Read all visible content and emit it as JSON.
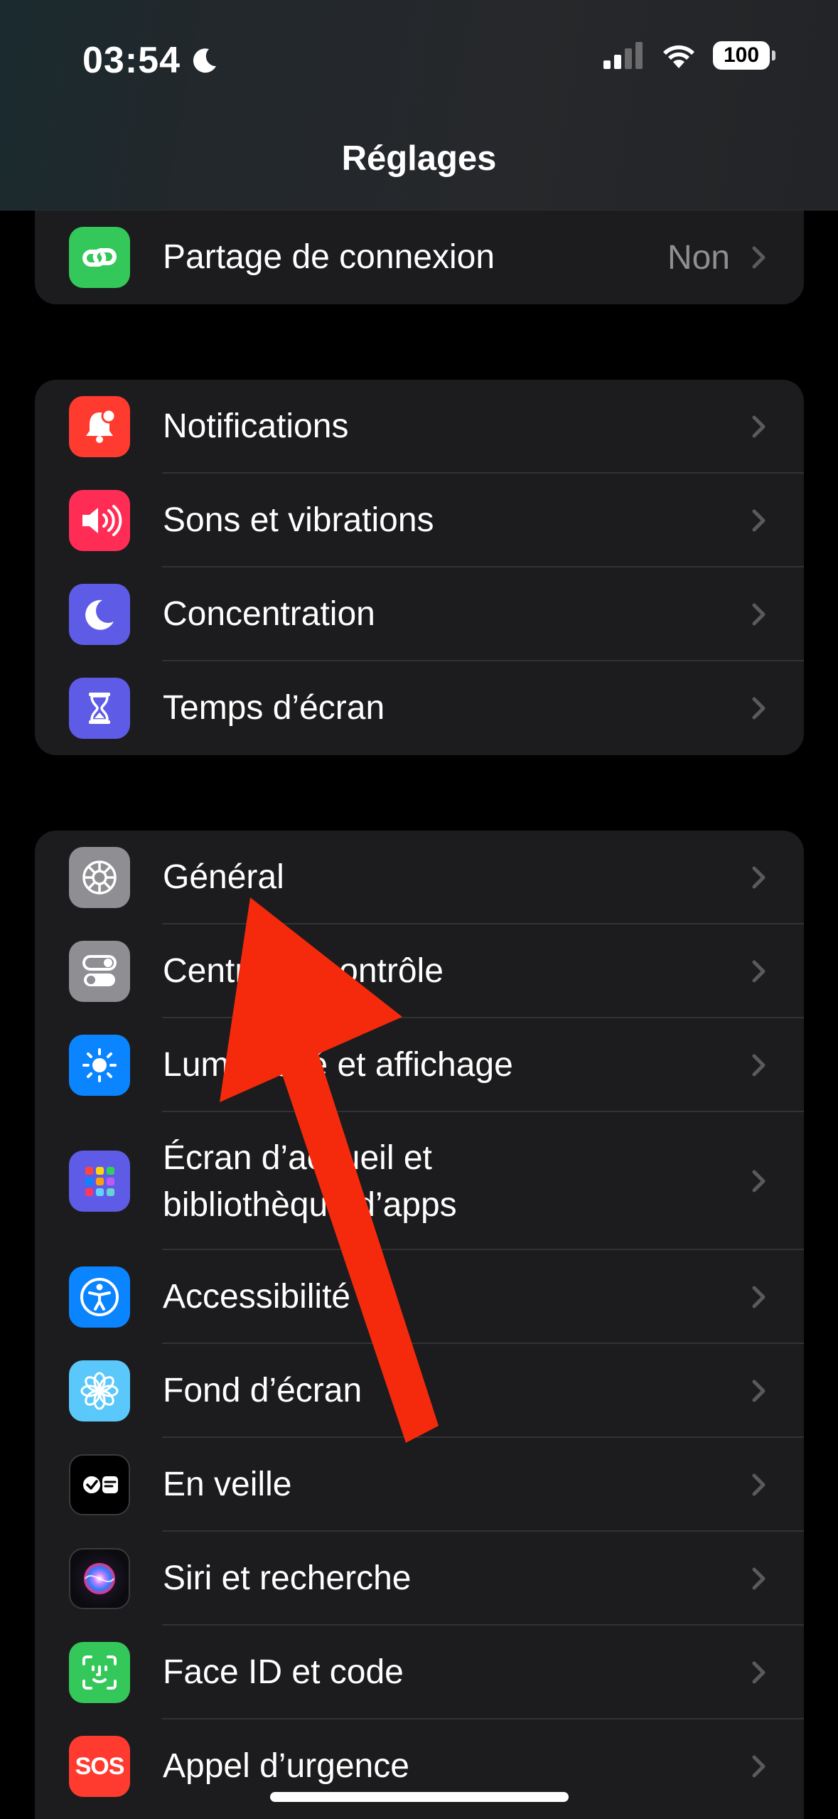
{
  "status": {
    "time": "03:54",
    "battery": "100"
  },
  "nav": {
    "title": "Réglages"
  },
  "colors": {
    "accent_arrow": "#f52a0c",
    "secondary_text": "#8e8e93"
  },
  "groups": [
    {
      "items": [
        {
          "label": "Partage de connexion",
          "value": "Non",
          "icon": "hotspot-icon"
        }
      ]
    },
    {
      "items": [
        {
          "label": "Notifications",
          "icon": "bell-icon"
        },
        {
          "label": "Sons et vibrations",
          "icon": "speaker-icon"
        },
        {
          "label": "Concentration",
          "icon": "moon-icon"
        },
        {
          "label": "Temps d’écran",
          "icon": "hourglass-icon"
        }
      ]
    },
    {
      "items": [
        {
          "label": "Général",
          "icon": "gear-icon"
        },
        {
          "label": "Centre de contrôle",
          "icon": "toggles-icon"
        },
        {
          "label": "Luminosité et affichage",
          "icon": "sun-icon"
        },
        {
          "label_line1": "Écran d’accueil et",
          "label_line2": "bibliothèque d’apps",
          "icon": "app-grid-icon"
        },
        {
          "label": "Accessibilité",
          "icon": "accessibility-icon"
        },
        {
          "label": "Fond d’écran",
          "icon": "flower-icon"
        },
        {
          "label": "En veille",
          "icon": "standby-icon"
        },
        {
          "label": "Siri et recherche",
          "icon": "siri-icon"
        },
        {
          "label": "Face ID et code",
          "icon": "face-id-icon"
        },
        {
          "label": "Appel d’urgence",
          "icon": "sos-icon",
          "icon_text": "SOS"
        }
      ]
    }
  ]
}
